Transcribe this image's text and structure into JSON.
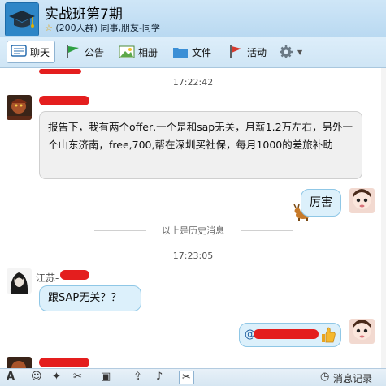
{
  "header": {
    "title": "实战班第7期",
    "subtitle_star": "☆",
    "subtitle": "(200人群) 同事,朋友-同学"
  },
  "tabs": [
    {
      "label": "聊天",
      "icon": "chat-icon"
    },
    {
      "label": "公告",
      "icon": "flag-icon"
    },
    {
      "label": "相册",
      "icon": "photo-icon"
    },
    {
      "label": "文件",
      "icon": "folder-icon"
    },
    {
      "label": "活动",
      "icon": "red-flag-icon"
    },
    {
      "label": "",
      "icon": "gear-icon"
    }
  ],
  "chat": {
    "time1": "17:22:42",
    "msg1": "报告下，我有两个offer,一个是和sap无关，月薪1.2万左右，另外一个山东济南，free,700,帮在深圳买社保，每月1000的差旅补助",
    "msg2": "厉害",
    "history_divider": "以上是历史消息",
    "time2": "17:23:05",
    "sender3": "江苏-",
    "msg3": "跟SAP无关？？",
    "msg4_prefix": "@"
  },
  "bottom": {
    "history_label": "消息记录",
    "tools": [
      "A",
      "☺",
      "✦",
      "✂",
      "▣",
      "⇪",
      "♪",
      "✂"
    ]
  },
  "colors": {
    "accent": "#2e86c7",
    "redact": "#e41e1e",
    "bubble_blue": "#dcf0fb"
  }
}
